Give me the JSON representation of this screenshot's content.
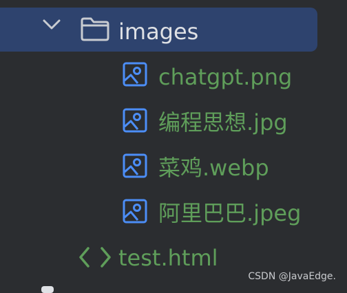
{
  "colors": {
    "background": "#2b2d30",
    "selection": "#2e436e",
    "folder_text": "#dfe1e5",
    "file_text": "#5f9e5a",
    "image_icon": "#4c8ef7",
    "html_icon": "#5f9e5a"
  },
  "tree": {
    "folder": {
      "name": "images",
      "icon": "folder-icon",
      "expanded": true
    },
    "images": [
      {
        "name": "chatgpt.png",
        "icon": "image-file-icon"
      },
      {
        "name": "编程思想.jpg",
        "icon": "image-file-icon"
      },
      {
        "name": "菜鸡.webp",
        "icon": "image-file-icon"
      },
      {
        "name": "阿里巴巴.jpeg",
        "icon": "image-file-icon"
      }
    ],
    "html_file": {
      "name": "test.html",
      "icon": "code-icon"
    }
  },
  "watermark": "CSDN @JavaEdge."
}
